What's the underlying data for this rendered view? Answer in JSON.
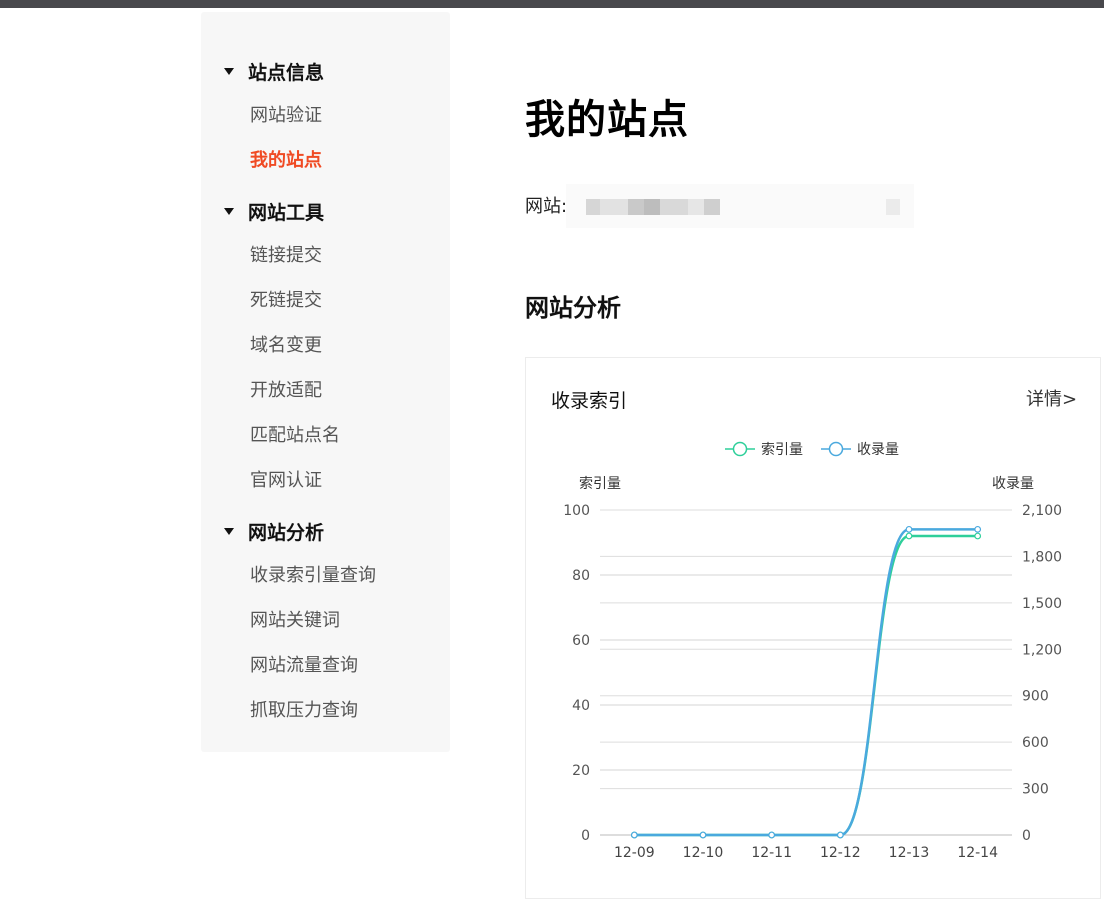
{
  "sidebar": {
    "sections": [
      {
        "title": "站点信息",
        "items": [
          "网站验证",
          "我的站点"
        ]
      },
      {
        "title": "网站工具",
        "items": [
          "链接提交",
          "死链提交",
          "域名变更",
          "开放适配",
          "匹配站点名",
          "官网认证"
        ]
      },
      {
        "title": "网站分析",
        "items": [
          "收录索引量查询",
          "网站关键词",
          "网站流量查询",
          "抓取压力查询"
        ]
      }
    ],
    "active_item": "我的站点"
  },
  "main": {
    "title": "我的站点",
    "site_label": "网站:",
    "analysis_heading": "网站分析",
    "card": {
      "title": "收录索引",
      "more": "详情>"
    }
  },
  "chart_data": {
    "type": "line",
    "x": [
      "12-09",
      "12-10",
      "12-11",
      "12-12",
      "12-13",
      "12-14"
    ],
    "series": [
      {
        "name": "索引量",
        "axis": "left",
        "values": [
          0,
          0,
          0,
          0,
          92,
          92
        ],
        "color": "#2ecf9a"
      },
      {
        "name": "收录量",
        "axis": "right",
        "values": [
          0,
          0,
          0,
          0,
          1975,
          1975
        ],
        "color": "#4aa9de"
      }
    ],
    "y_left": {
      "label": "索引量",
      "ticks": [
        0,
        20,
        40,
        60,
        80,
        100
      ],
      "range": [
        0,
        100
      ]
    },
    "y_right": {
      "label": "收录量",
      "ticks": [
        "0",
        "300",
        "600",
        "900",
        "1,200",
        "1,500",
        "1,800",
        "2,100"
      ],
      "range": [
        0,
        2100
      ]
    },
    "legend_position": "top-center",
    "grid": true
  }
}
